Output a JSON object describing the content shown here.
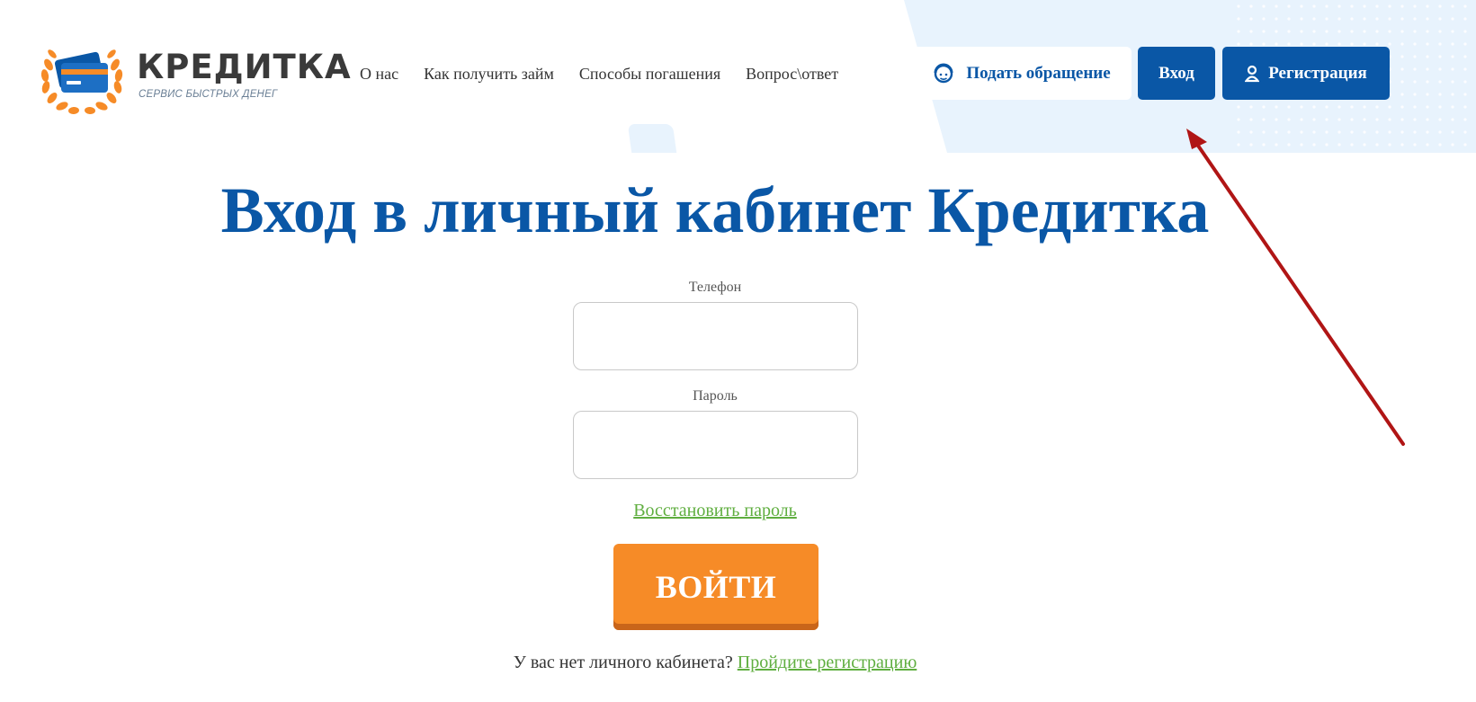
{
  "logo": {
    "title": "КРЕДИТКА",
    "subtitle": "СЕРВИС БЫСТРЫХ ДЕНЕГ"
  },
  "nav": {
    "items": [
      {
        "label": "О нас"
      },
      {
        "label": "Как получить займ"
      },
      {
        "label": "Способы погашения"
      },
      {
        "label": "Вопрос\\ответ"
      }
    ]
  },
  "header_buttons": {
    "appeal_label": "Подать обращение",
    "login_label": "Вход",
    "register_label": "Регистрация"
  },
  "main": {
    "title": "Вход в личный кабинет Кредитка",
    "phone_label": "Телефон",
    "phone_value": "",
    "password_label": "Пароль",
    "password_value": "",
    "restore_link": "Восстановить пароль",
    "submit_label": "ВОЙТИ",
    "no_account_text": "У вас нет личного кабинета?",
    "register_link": "Пройдите регистрацию"
  },
  "colors": {
    "brand_blue": "#0a57a6",
    "accent_orange": "#f68b27",
    "link_green": "#5fae3f",
    "annotation_arrow": "#b01515"
  },
  "icons": [
    "laurel-wreath-icon",
    "credit-card-icon",
    "support-agent-icon",
    "user-icon"
  ]
}
